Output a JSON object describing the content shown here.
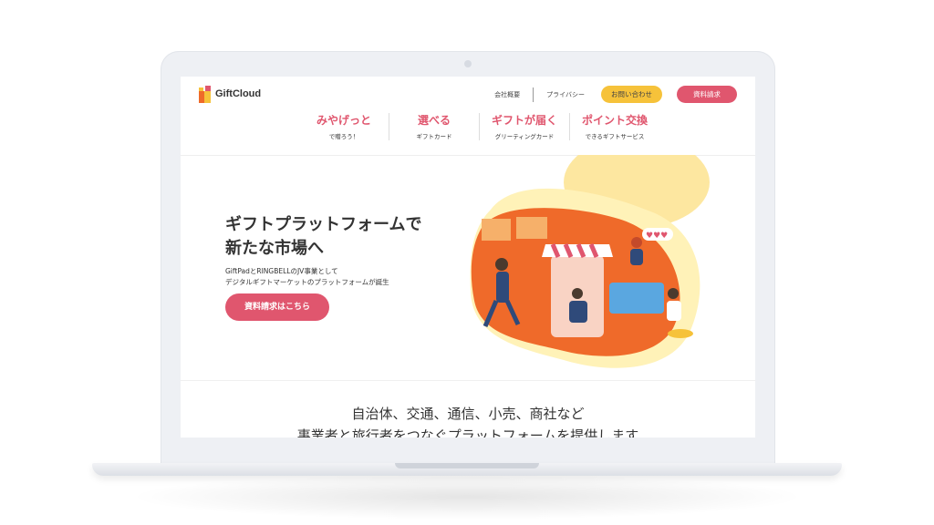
{
  "site": {
    "logo_text": "GiftCloud"
  },
  "header": {
    "links": [
      "会社概要",
      "プライバシー"
    ],
    "contact_button": "お問い合わせ",
    "docs_button": "資料請求"
  },
  "nav": [
    {
      "title": "みやげっと",
      "sub": "で贈ろう！"
    },
    {
      "title": "選べる",
      "sub": "ギフトカード"
    },
    {
      "title": "ギフトが届く",
      "sub": "グリーティングカード"
    },
    {
      "title": "ポイント交換",
      "sub": "できるギフトサービス"
    }
  ],
  "hero": {
    "title_line1": "ギフトプラットフォームで",
    "title_line2": "新たな市場へ",
    "desc_line1": "GiftPadとRINGBELLのJV事業として",
    "desc_line2": "デジタルギフトマーケットのプラットフォームが誕生",
    "cta": "資料請求はこちら"
  },
  "section": {
    "line1": "自治体、交通、通信、小売、商社など",
    "line2": "事業者と旅行者をつなぐプラットフォームを提供します"
  },
  "colors": {
    "accent_pink": "#e0566e",
    "accent_yellow": "#f6c23a",
    "illustration_orange": "#ef6a2a"
  }
}
